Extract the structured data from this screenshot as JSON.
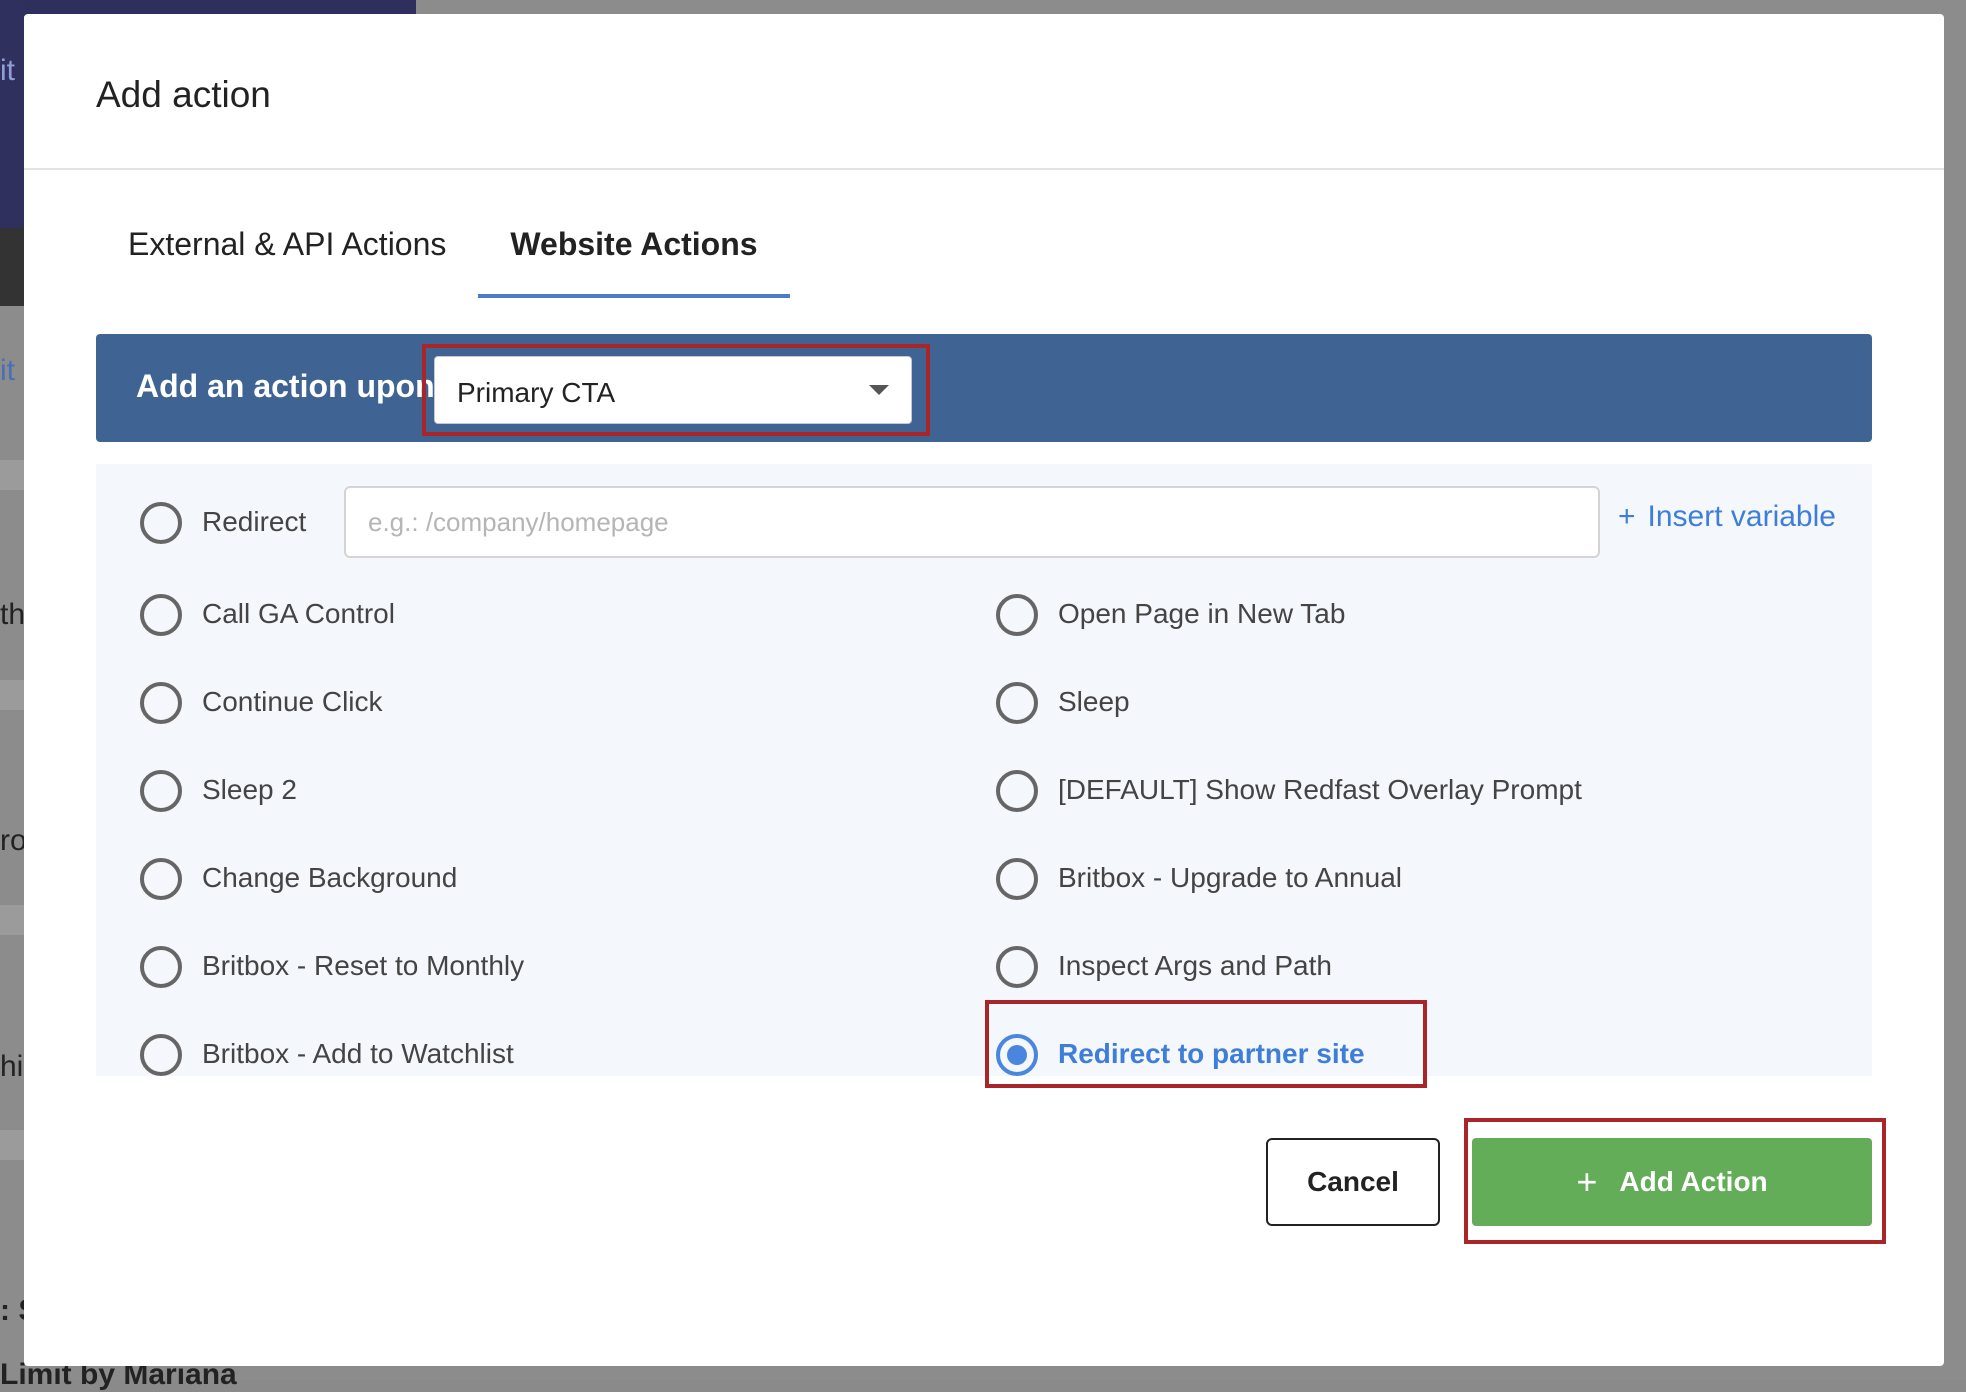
{
  "background": {
    "fragments": [
      "it",
      "it",
      "th",
      "ro",
      "hi"
    ],
    "bottom_text": ": S",
    "bottom_text2": "Limit by Mariana"
  },
  "modal": {
    "title": "Add action",
    "tabs": [
      {
        "label": "External & API Actions",
        "active": false
      },
      {
        "label": "Website Actions",
        "active": true
      }
    ],
    "trigger": {
      "label": "Add an action upon",
      "selected": "Primary CTA"
    },
    "redirect": {
      "label": "Redirect",
      "placeholder": "e.g.: /company/homepage",
      "value": ""
    },
    "insert_variable": {
      "icon": "plus-icon",
      "label": "Insert variable"
    },
    "options_left": [
      {
        "label": "Call GA Control",
        "checked": false
      },
      {
        "label": "Continue Click",
        "checked": false
      },
      {
        "label": "Sleep 2",
        "checked": false
      },
      {
        "label": "Change Background",
        "checked": false
      },
      {
        "label": "Britbox - Reset to Monthly",
        "checked": false
      },
      {
        "label": "Britbox - Add to Watchlist",
        "checked": false
      }
    ],
    "options_right": [
      {
        "label": "Open Page in New Tab",
        "checked": false
      },
      {
        "label": "Sleep",
        "checked": false
      },
      {
        "label": "[DEFAULT] Show Redfast Overlay Prompt",
        "checked": false
      },
      {
        "label": "Britbox - Upgrade to Annual",
        "checked": false
      },
      {
        "label": "Inspect Args and Path",
        "checked": false
      },
      {
        "label": "Redirect to partner site",
        "checked": true
      }
    ],
    "buttons": {
      "cancel": "Cancel",
      "add": "Add Action",
      "add_icon": "plus-icon"
    },
    "colors": {
      "accent": "#4a86e0",
      "bar": "#3f6494",
      "add_button": "#63ad58",
      "highlight": "#a8262a"
    }
  }
}
